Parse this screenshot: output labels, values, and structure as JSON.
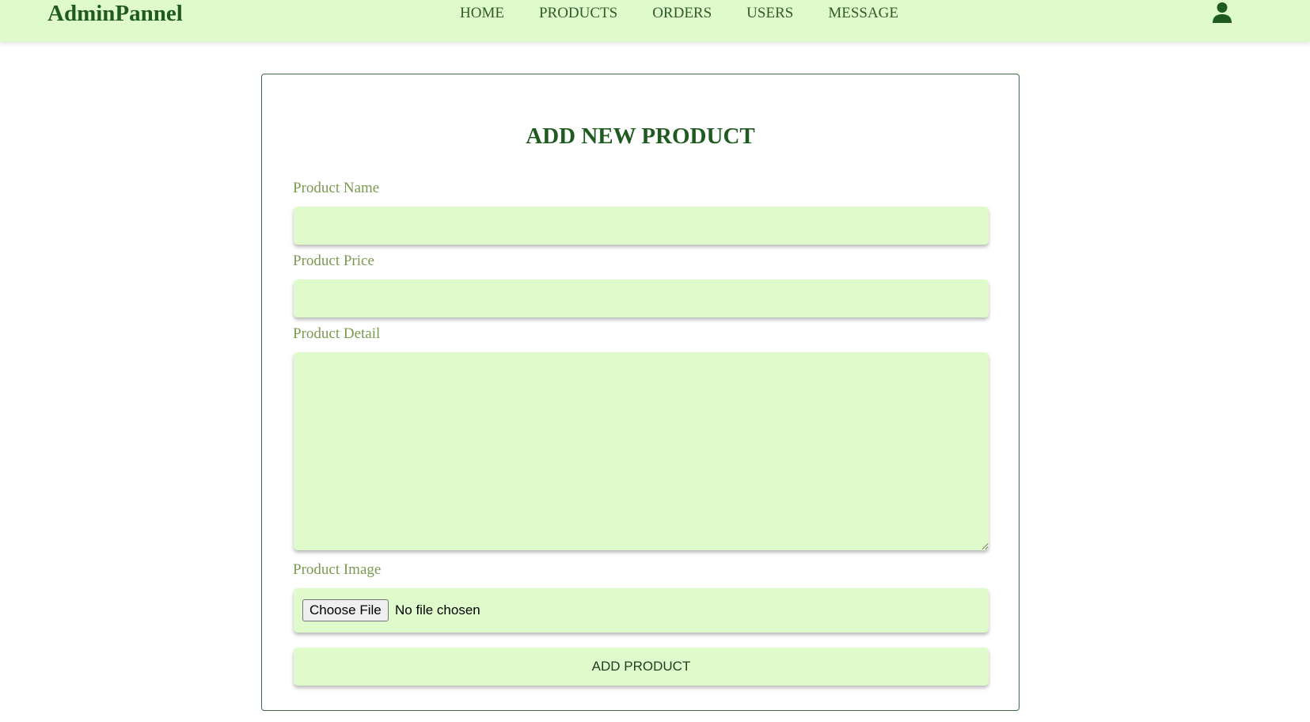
{
  "header": {
    "logo": "AdminPannel",
    "nav": [
      "HOME",
      "PRODUCTS",
      "ORDERS",
      "USERS",
      "MESSAGE"
    ],
    "user_icon": "user-icon"
  },
  "form": {
    "title": "ADD NEW PRODUCT",
    "name_label": "Product Name",
    "name_value": "",
    "price_label": "Product Price",
    "price_value": "",
    "detail_label": "Product Detail",
    "detail_value": "",
    "image_label": "Product Image",
    "choose_file": "Choose File",
    "file_status": "No file chosen",
    "submit_label": "ADD PRODUCT"
  },
  "colors": {
    "header_bg": "#e0fbcb",
    "field_bg": "#e0fbcb",
    "brand_green": "#1f5a1f",
    "label_green": "#7a9a52"
  }
}
